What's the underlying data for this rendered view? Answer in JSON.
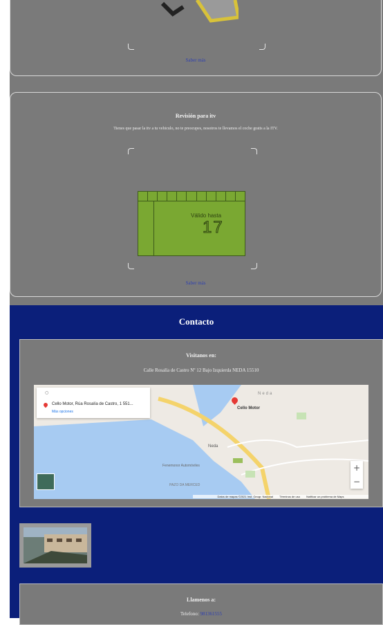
{
  "service_card_top": {
    "link": "Saber más"
  },
  "service_card_itv": {
    "title": "Revisión para itv",
    "description": "Tienes que pasar la itv a tu vehiculo, no te preocupes, nosotros te llevamos el coche gratis a la ITV.",
    "sticker_text": "Válido hasta",
    "sticker_number": "17",
    "link": "Saber más"
  },
  "contact": {
    "title": "Contacto",
    "visit_title": "Visitanos en:",
    "address": "Calle Rosalía de Castro Nº 12 Bajo Izquierda NEDA 15510",
    "map": {
      "place_card_title": "Cello Motor, Rúa Rosalía de Castro, 1 551...",
      "place_card_link": "Más opciones",
      "marker_label": "Cello Motor",
      "town_label": "Neda",
      "label_neda_station": "Neda",
      "label_fenemonor": "Fenemonor Automóviles",
      "label_pazo": "PAZO DA MERCED",
      "zoom_in": "+",
      "zoom_out": "−",
      "footer_data": "Datos de mapas ©2021 Inst. Geogr. Nacional",
      "footer_terms": "Términos de uso",
      "footer_report": "Notificar un problema de Maps"
    },
    "call_title": "Llamenos a:",
    "phone_label": "Telefono:",
    "phone_value": "981361555"
  },
  "colors": {
    "navy": "#0b1f7a",
    "gray": "#7a7a7a",
    "sticker_green": "#7aa832"
  }
}
